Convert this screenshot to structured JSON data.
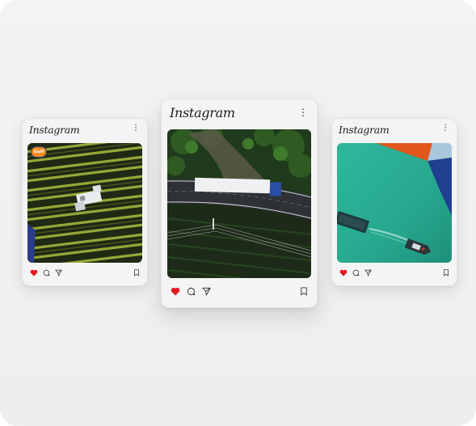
{
  "cards": [
    {
      "id": "left",
      "brand": "Instagram",
      "photo": "aerial-vineyard-tractor",
      "badge": "Gulf",
      "liked": true,
      "icons": [
        "heart-icon",
        "comment-icon",
        "send-icon",
        "bookmark-icon",
        "more-icon"
      ]
    },
    {
      "id": "center",
      "brand": "Instagram",
      "photo": "aerial-truck-on-highway",
      "liked": true,
      "icons": [
        "heart-icon",
        "comment-icon",
        "send-icon",
        "bookmark-icon",
        "more-icon"
      ]
    },
    {
      "id": "right",
      "brand": "Instagram",
      "photo": "aerial-boats-on-water",
      "liked": true,
      "icons": [
        "heart-icon",
        "comment-icon",
        "send-icon",
        "bookmark-icon",
        "more-icon"
      ]
    }
  ],
  "colors": {
    "like_red": "#e0181f",
    "background": "#f1f1f1",
    "card": "#f4f4f4",
    "text": "#1c1c1c"
  }
}
